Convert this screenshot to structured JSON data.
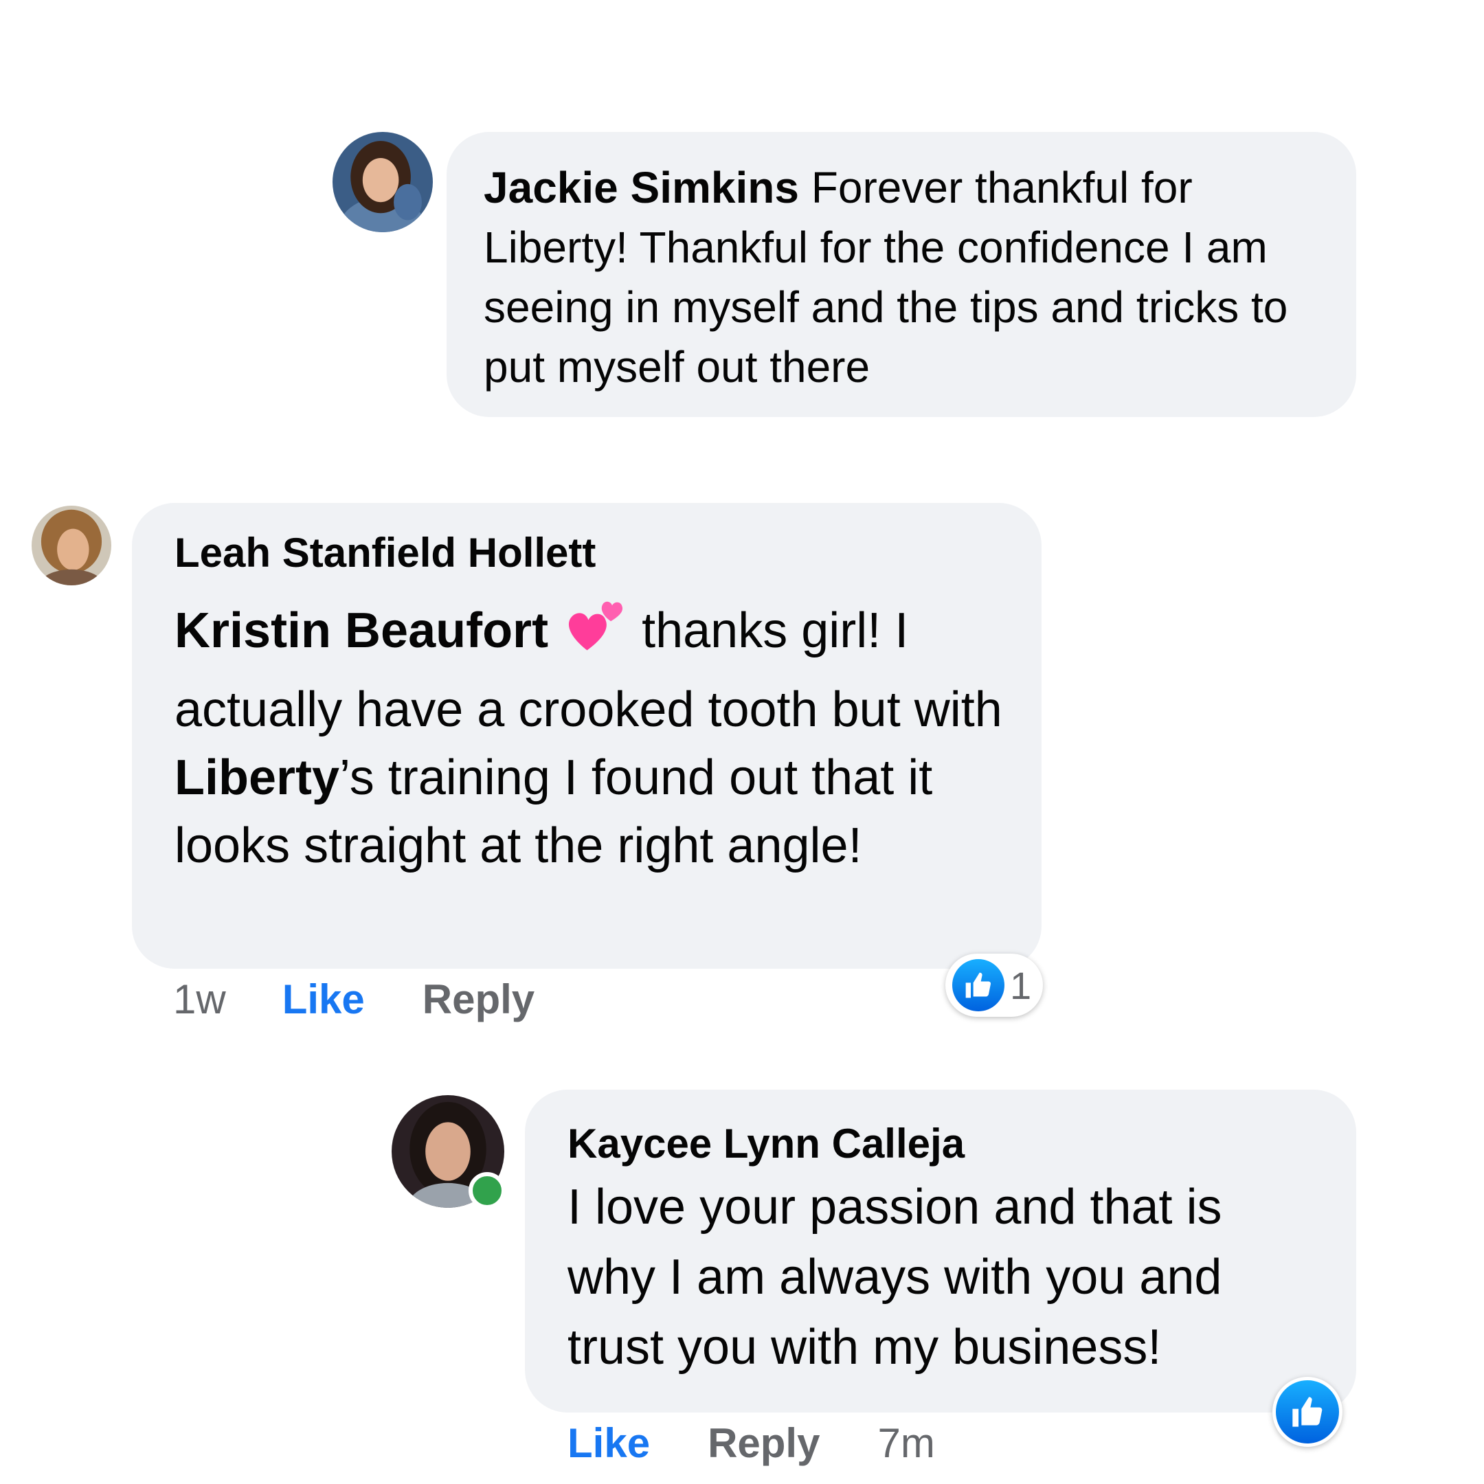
{
  "comments": [
    {
      "author": "Jackie Simkins",
      "text": "Forever thankful for Liberty! Thankful for the confidence I am seeing in myself and the tips and tricks to put myself out there"
    },
    {
      "author": "Leah Stanfield Hollett",
      "mention": "Kristin Beaufort",
      "emoji_icon": "two-hearts-icon",
      "text_part1": " thanks girl! I actually have a crooked tooth but with ",
      "mention2": "Liberty",
      "text_part2": "’s training I found out that it looks straight at the right angle!",
      "time": "1w",
      "like_label": "Like",
      "reply_label": "Reply",
      "reaction_count": "1"
    },
    {
      "author": "Kaycee Lynn Calleja",
      "text": "I love your passion and that is why I am always with you and trust you with my business!",
      "like_label": "Like",
      "reply_label": "Reply",
      "time": "7m",
      "online": true
    }
  ],
  "colors": {
    "bubble": "#f0f2f5",
    "like_blue": "#1877f2",
    "meta_gray": "#65676b",
    "online_green": "#31a24c"
  }
}
